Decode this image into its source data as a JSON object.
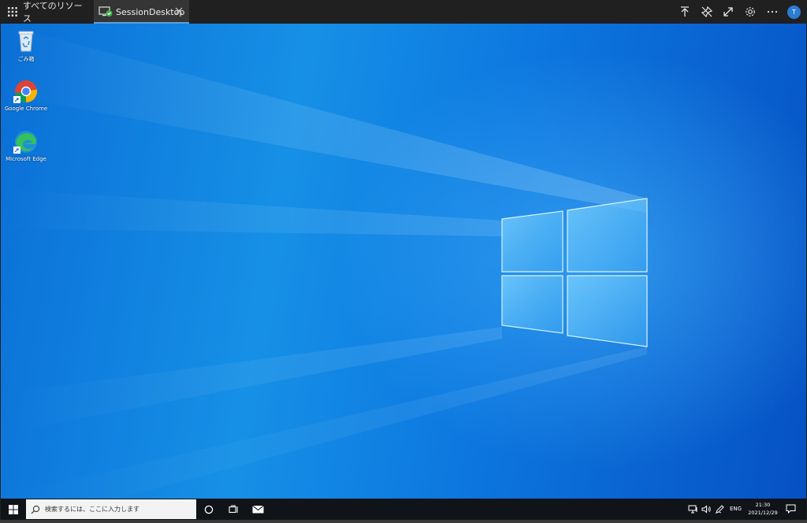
{
  "topbar": {
    "all_resources_label": "すべてのリソース",
    "session_tab_label": "SessionDesktop",
    "avatar_initial": "T",
    "icons": [
      "grid-icon",
      "desktop-connected-icon",
      "close-icon",
      "upload-icon",
      "unpin-icon",
      "expand-icon",
      "gear-icon",
      "more-icon"
    ]
  },
  "desktop": {
    "icons": [
      {
        "name": "recycle-bin",
        "label": "ごみ箱"
      },
      {
        "name": "google-chrome",
        "label": "Google Chrome"
      },
      {
        "name": "microsoft-edge",
        "label": "Microsoft Edge"
      }
    ]
  },
  "taskbar": {
    "search_placeholder": "検索するには、ここに入力します",
    "language": "ENG",
    "time": "21:30",
    "date": "2021/12/29",
    "icons": [
      "windows-start-icon",
      "search-icon",
      "cortana-icon",
      "task-view-icon",
      "mail-icon",
      "network-icon",
      "volume-icon",
      "pen-icon",
      "notification-icon"
    ]
  },
  "colors": {
    "topbar_bg": "#202020",
    "tab_bg": "#353535",
    "tab_accent": "#5aa0e0",
    "desktop_blue": "#1690e6",
    "taskbar_bg": "#101418",
    "avatar_bg": "#2b7cd3"
  }
}
